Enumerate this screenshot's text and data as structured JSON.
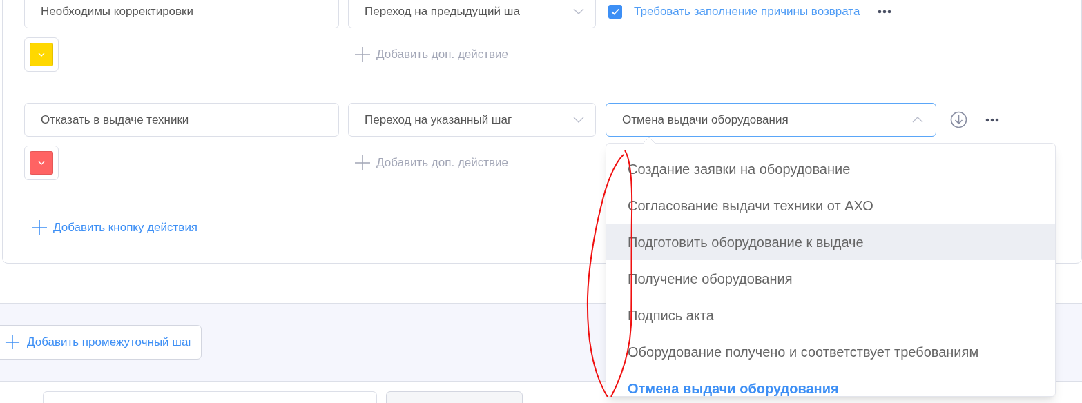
{
  "action_buttons": [
    {
      "name": "Необходимы корректировки",
      "action": "Переход на предыдущий ша",
      "color": "#ffd800",
      "option": {
        "kind": "checkbox",
        "label": "Требовать заполнение причины возврата",
        "checked": true
      },
      "add_action": "Добавить доп. действие"
    },
    {
      "name": "Отказать в выдаче техники",
      "action": "Переход на указанный шаг",
      "color": "#ff6363",
      "option": {
        "kind": "step_select",
        "value": "Отмена выдачи оборудования",
        "expanded": true
      },
      "add_action": "Добавить доп. действие"
    }
  ],
  "add_action_button": "Добавить кнопку действия",
  "add_step_button": "Добавить промежуточный шаг",
  "step_dropdown": {
    "items": [
      {
        "label": "Создание заявки на оборудование",
        "selected": false,
        "hovered": false
      },
      {
        "label": "Согласование выдачи техники от АХО",
        "selected": false,
        "hovered": false
      },
      {
        "label": "Подготовить оборудование к выдаче",
        "selected": false,
        "hovered": true
      },
      {
        "label": "Получение оборудования",
        "selected": false,
        "hovered": false
      },
      {
        "label": "Подпись акта",
        "selected": false,
        "hovered": false
      },
      {
        "label": "Оборудование получено и соответствует требованиям",
        "selected": false,
        "hovered": false
      },
      {
        "label": "Отмена выдачи оборудования",
        "selected": true,
        "hovered": false
      }
    ]
  }
}
